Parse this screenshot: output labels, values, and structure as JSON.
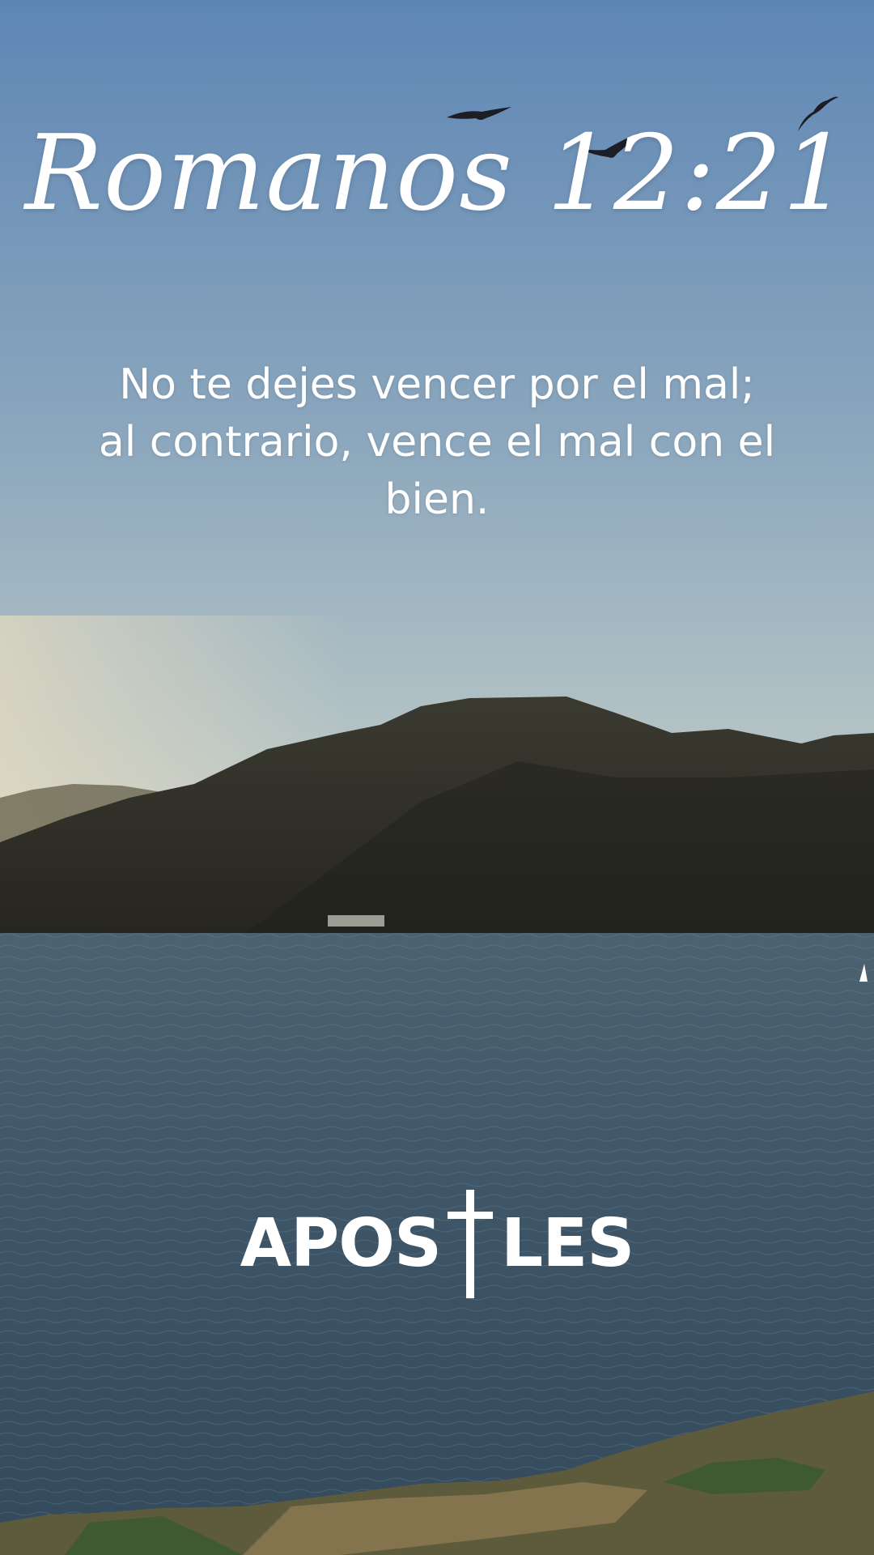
{
  "title": "Romanos 12:21",
  "verse": "No te dejes vencer por el mal; al contrario, vence el mal con el bien.",
  "brand": {
    "left": "APOS",
    "right": "LES",
    "mark_icon": "cross-icon"
  },
  "colors": {
    "sky_top": "#5e86b5",
    "sky_horizon": "#cfd3c6",
    "mountains": "#2c2d26",
    "water": "#3c5466",
    "text": "#ffffff"
  }
}
